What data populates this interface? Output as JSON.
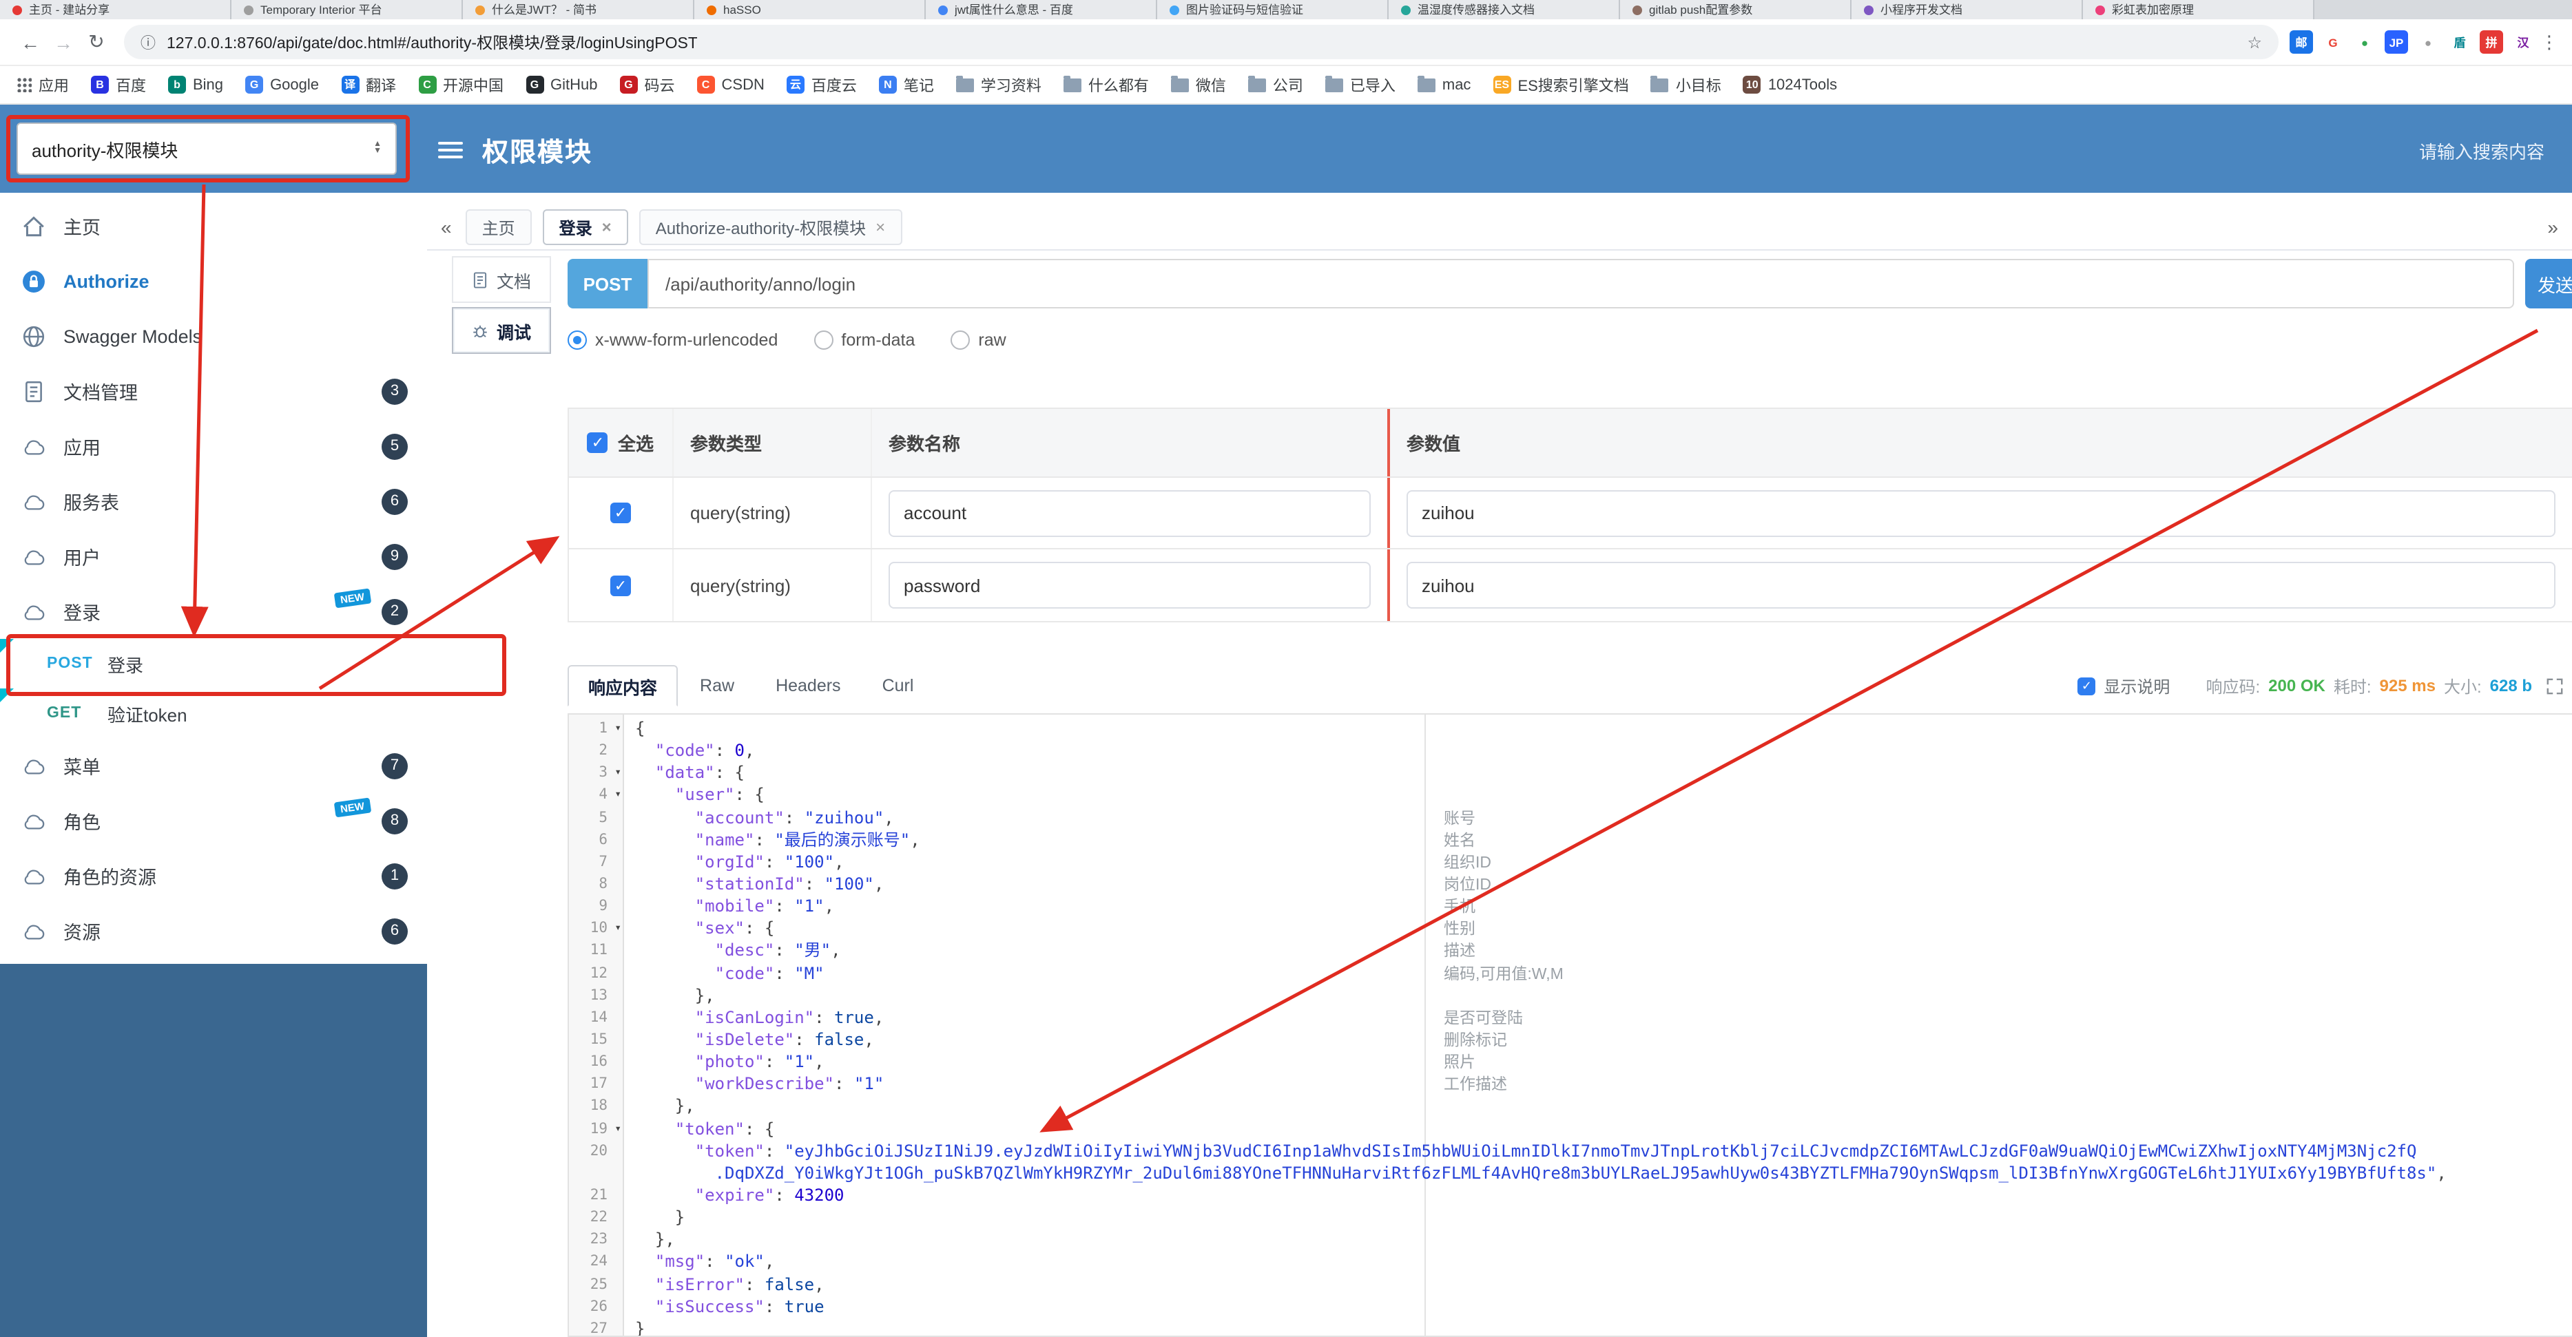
{
  "colors": {
    "header_blue": "#4a86c0",
    "sidebar_fill_blue": "#3a6790",
    "annotation_red": "#e02b20",
    "post_badge_blue": "#54a6dd",
    "send_button_blue": "#3e8ed8",
    "status_ok_green": "#46b450",
    "time_orange": "#ef9537",
    "size_teal": "#1c9fd6"
  },
  "browser": {
    "nav": {
      "back": "←",
      "forward": "→",
      "reload": "↻",
      "info": "ⓘ",
      "star": "☆",
      "menu": "⋮"
    },
    "url": "127.0.0.1:8760/api/gate/doc.html#/authority-权限模块/登录/loginUsingPOST",
    "tabs": [
      {
        "title": "主页 - 建站分享",
        "color": "#e53935"
      },
      {
        "title": "Temporary Interior 平台",
        "color": "#9e9e9e"
      },
      {
        "title": "什么是JWT？ - 简书",
        "color": "#f29d38"
      },
      {
        "title": "haSSO",
        "color": "#ef6c00"
      },
      {
        "title": "jwt属性什么意思 - 百度",
        "color": "#4285f4"
      },
      {
        "title": "图片验证码与短信验证",
        "color": "#42a5f5"
      },
      {
        "title": "温湿度传感器接入文档",
        "color": "#26a69a"
      },
      {
        "title": "gitlab push配置参数",
        "color": "#8d6e63"
      },
      {
        "title": "小程序开发文档",
        "color": "#7e57c2"
      },
      {
        "title": "彩虹表加密原理",
        "color": "#ec407a"
      }
    ],
    "extensions": [
      {
        "glyph": "邮",
        "bg": "#1a73e8",
        "fg": "#ffffff"
      },
      {
        "glyph": "G",
        "bg": "#ffffff",
        "fg": "#ea4335"
      },
      {
        "glyph": "●",
        "bg": "#ffffff",
        "fg": "#34a853"
      },
      {
        "glyph": "JP",
        "bg": "#2962ff",
        "fg": "#ffffff"
      },
      {
        "glyph": "●",
        "bg": "#ffffff",
        "fg": "#9e9e9e"
      },
      {
        "glyph": "盾",
        "bg": "#ffffff",
        "fg": "#00838f"
      },
      {
        "glyph": "拼",
        "bg": "#e53935",
        "fg": "#ffffff"
      },
      {
        "glyph": "汉",
        "bg": "#ffffff",
        "fg": "#7b1fa2"
      }
    ],
    "bookmarks": [
      {
        "label": "应用",
        "kind": "apps"
      },
      {
        "label": "百度",
        "kind": "chip",
        "letter": "B",
        "bg": "#2932e1"
      },
      {
        "label": "Bing",
        "kind": "chip",
        "letter": "b",
        "bg": "#008373"
      },
      {
        "label": "Google",
        "kind": "chip",
        "letter": "G",
        "bg": "#4285f4"
      },
      {
        "label": "翻译",
        "kind": "chip",
        "letter": "译",
        "bg": "#1a73e8"
      },
      {
        "label": "开源中国",
        "kind": "chip",
        "letter": "C",
        "bg": "#2e9e44"
      },
      {
        "label": "GitHub",
        "kind": "chip",
        "letter": "G",
        "bg": "#24292e"
      },
      {
        "label": "码云",
        "kind": "chip",
        "letter": "G",
        "bg": "#c71d23"
      },
      {
        "label": "CSDN",
        "kind": "chip",
        "letter": "C",
        "bg": "#fc5531"
      },
      {
        "label": "百度云",
        "kind": "chip",
        "letter": "云",
        "bg": "#2979ff"
      },
      {
        "label": "笔记",
        "kind": "chip",
        "letter": "N",
        "bg": "#3b7ef2"
      },
      {
        "label": "学习资料",
        "kind": "folder"
      },
      {
        "label": "什么都有",
        "kind": "folder"
      },
      {
        "label": "微信",
        "kind": "folder"
      },
      {
        "label": "公司",
        "kind": "folder"
      },
      {
        "label": "已导入",
        "kind": "folder"
      },
      {
        "label": "mac",
        "kind": "folder"
      },
      {
        "label": "ES搜索引擎文档",
        "kind": "chip",
        "letter": "ES",
        "bg": "#f9a825"
      },
      {
        "label": "小目标",
        "kind": "folder"
      },
      {
        "label": "1024Tools",
        "kind": "chip",
        "letter": "10",
        "bg": "#6d4c41"
      }
    ]
  },
  "header": {
    "project_select": "authority-权限模块",
    "title": "权限模块",
    "search_placeholder": "请输入搜索内容"
  },
  "sidebar": {
    "items": [
      {
        "label": "主页",
        "icon": "home",
        "type": "link"
      },
      {
        "label": "Authorize",
        "icon": "lock",
        "type": "link",
        "accent": true
      },
      {
        "label": "Swagger Models",
        "icon": "globe",
        "type": "link"
      },
      {
        "label": "文档管理",
        "icon": "doc",
        "badge": "3"
      },
      {
        "label": "应用",
        "icon": "cloud",
        "badge": "5"
      },
      {
        "label": "服务表",
        "icon": "cloud",
        "badge": "6"
      },
      {
        "label": "用户",
        "icon": "cloud",
        "badge": "9"
      },
      {
        "label": "登录",
        "icon": "cloud",
        "badge": "2",
        "new": true
      },
      {
        "label": "登录",
        "method": "POST",
        "type": "endpoint",
        "selected": true
      },
      {
        "label": "验证token",
        "method": "GET",
        "type": "endpoint"
      },
      {
        "label": "菜单",
        "icon": "cloud",
        "badge": "7"
      },
      {
        "label": "角色",
        "icon": "cloud",
        "badge": "8",
        "new": true
      },
      {
        "label": "角色的资源",
        "icon": "cloud",
        "badge": "1"
      },
      {
        "label": "资源",
        "icon": "cloud",
        "badge": "6"
      }
    ]
  },
  "doc_tabs": {
    "left_chevron": "«",
    "right_chevron": "»",
    "tabs": [
      {
        "label": "主页",
        "closable": false,
        "active": false
      },
      {
        "label": "登录",
        "closable": true,
        "active": true
      },
      {
        "label": "Authorize-authority-权限模块",
        "closable": true,
        "active": false
      }
    ]
  },
  "panel_tabs": [
    {
      "label": "文档",
      "icon": "doc",
      "active": false
    },
    {
      "label": "调试",
      "icon": "debug",
      "active": true
    }
  ],
  "request": {
    "method": "POST",
    "url": "/api/authority/anno/login",
    "send_label": "发送",
    "content_types": [
      "x-www-form-urlencoded",
      "form-data",
      "raw"
    ],
    "selected_type": "x-www-form-urlencoded"
  },
  "params_table": {
    "select_all_label": "全选",
    "headers": [
      "参数类型",
      "参数名称",
      "参数值"
    ],
    "rows": [
      {
        "checked": true,
        "type": "query(string)",
        "name": "account",
        "value": "zuihou"
      },
      {
        "checked": true,
        "type": "query(string)",
        "name": "password",
        "value": "zuihou"
      }
    ]
  },
  "response": {
    "tabs": [
      "响应内容",
      "Raw",
      "Headers",
      "Curl"
    ],
    "active_tab": "响应内容",
    "show_desc": "显示说明",
    "meta": [
      {
        "label": "响应码:",
        "value": "200 OK",
        "cls": "ok"
      },
      {
        "label": "耗时:",
        "value": "925 ms",
        "cls": "ms"
      },
      {
        "label": "大小:",
        "value": "628 b",
        "cls": "sz"
      }
    ]
  },
  "editor": {
    "lines": [
      {
        "n": 1,
        "fold": true,
        "t": [
          [
            "pu",
            "{"
          ]
        ]
      },
      {
        "n": 2,
        "t": [
          [
            "pu",
            "  "
          ],
          [
            "ky",
            "\"code\""
          ],
          [
            "pu",
            ": "
          ],
          [
            "nu",
            "0"
          ],
          [
            "pu",
            ","
          ]
        ]
      },
      {
        "n": 3,
        "fold": true,
        "t": [
          [
            "pu",
            "  "
          ],
          [
            "ky",
            "\"data\""
          ],
          [
            "pu",
            ": {"
          ]
        ]
      },
      {
        "n": 4,
        "fold": true,
        "t": [
          [
            "pu",
            "    "
          ],
          [
            "ky",
            "\"user\""
          ],
          [
            "pu",
            ": {"
          ]
        ]
      },
      {
        "n": 5,
        "c": "账号",
        "t": [
          [
            "pu",
            "      "
          ],
          [
            "ky",
            "\"account\""
          ],
          [
            "pu",
            ": "
          ],
          [
            "st",
            "\"zuihou\""
          ],
          [
            "pu",
            ","
          ]
        ]
      },
      {
        "n": 6,
        "c": "姓名",
        "t": [
          [
            "pu",
            "      "
          ],
          [
            "ky",
            "\"name\""
          ],
          [
            "pu",
            ": "
          ],
          [
            "st",
            "\"最后的演示账号\""
          ],
          [
            "pu",
            ","
          ]
        ]
      },
      {
        "n": 7,
        "c": "组织ID",
        "t": [
          [
            "pu",
            "      "
          ],
          [
            "ky",
            "\"orgId\""
          ],
          [
            "pu",
            ": "
          ],
          [
            "st",
            "\"100\""
          ],
          [
            "pu",
            ","
          ]
        ]
      },
      {
        "n": 8,
        "c": "岗位ID",
        "t": [
          [
            "pu",
            "      "
          ],
          [
            "ky",
            "\"stationId\""
          ],
          [
            "pu",
            ": "
          ],
          [
            "st",
            "\"100\""
          ],
          [
            "pu",
            ","
          ]
        ]
      },
      {
        "n": 9,
        "c": "手机",
        "t": [
          [
            "pu",
            "      "
          ],
          [
            "ky",
            "\"mobile\""
          ],
          [
            "pu",
            ": "
          ],
          [
            "st",
            "\"1\""
          ],
          [
            "pu",
            ","
          ]
        ]
      },
      {
        "n": 10,
        "fold": true,
        "c": "性别",
        "t": [
          [
            "pu",
            "      "
          ],
          [
            "ky",
            "\"sex\""
          ],
          [
            "pu",
            ": {"
          ]
        ]
      },
      {
        "n": 11,
        "c": "描述",
        "t": [
          [
            "pu",
            "        "
          ],
          [
            "ky",
            "\"desc\""
          ],
          [
            "pu",
            ": "
          ],
          [
            "st",
            "\"男\""
          ],
          [
            "pu",
            ","
          ]
        ]
      },
      {
        "n": 12,
        "c": "编码,可用值:W,M",
        "t": [
          [
            "pu",
            "        "
          ],
          [
            "ky",
            "\"code\""
          ],
          [
            "pu",
            ": "
          ],
          [
            "st",
            "\"M\""
          ]
        ]
      },
      {
        "n": 13,
        "t": [
          [
            "pu",
            "      },"
          ]
        ]
      },
      {
        "n": 14,
        "c": "是否可登陆",
        "t": [
          [
            "pu",
            "      "
          ],
          [
            "ky",
            "\"isCanLogin\""
          ],
          [
            "pu",
            ": "
          ],
          [
            "bo",
            "true"
          ],
          [
            "pu",
            ","
          ]
        ]
      },
      {
        "n": 15,
        "c": "删除标记",
        "t": [
          [
            "pu",
            "      "
          ],
          [
            "ky",
            "\"isDelete\""
          ],
          [
            "pu",
            ": "
          ],
          [
            "bo",
            "false"
          ],
          [
            "pu",
            ","
          ]
        ]
      },
      {
        "n": 16,
        "c": "照片",
        "t": [
          [
            "pu",
            "      "
          ],
          [
            "ky",
            "\"photo\""
          ],
          [
            "pu",
            ": "
          ],
          [
            "st",
            "\"1\""
          ],
          [
            "pu",
            ","
          ]
        ]
      },
      {
        "n": 17,
        "c": "工作描述",
        "t": [
          [
            "pu",
            "      "
          ],
          [
            "ky",
            "\"workDescribe\""
          ],
          [
            "pu",
            ": "
          ],
          [
            "st",
            "\"1\""
          ]
        ]
      },
      {
        "n": 18,
        "t": [
          [
            "pu",
            "    },"
          ]
        ]
      },
      {
        "n": 19,
        "fold": true,
        "t": [
          [
            "pu",
            "    "
          ],
          [
            "ky",
            "\"token\""
          ],
          [
            "pu",
            ": {"
          ]
        ]
      },
      {
        "n": 20,
        "t": [
          [
            "pu",
            "      "
          ],
          [
            "ky",
            "\"token\""
          ],
          [
            "pu",
            ": "
          ],
          [
            "st",
            "\"eyJhbGciOiJSUzI1NiJ9.eyJzdWIiOiIyIiwiYWNjb3VudCI6Inp1aWhvdSIsIm5hbWUiOiLmnIDlkI7nmoTmvJTnpLrotKblj7ciLCJvcmdpZCI6MTAwLCJzdGF0aW9uaWQiOjEwMCwiZXhwIjoxNTY4MjM3Njc2fQ"
          ]
        ]
      },
      {
        "n": "",
        "t": [
          [
            "st",
            "        .DqDXZd_Y0iWkgYJt1OGh_puSkB7QZlWmYkH9RZYMr_2uDul6mi88YOneTFHNNuHarviRtf6zFLMLf4AvHQre8m3bUYLRaeLJ95awhUyw0s43BYZTLFMHa79OynSWqpsm_lDI3BfnYnwXrgGOGTeL6htJ1YUIx6Yy19BYBfUft8s\""
          ],
          [
            "pu",
            ","
          ]
        ]
      },
      {
        "n": 21,
        "t": [
          [
            "pu",
            "      "
          ],
          [
            "ky",
            "\"expire\""
          ],
          [
            "pu",
            ": "
          ],
          [
            "nu",
            "43200"
          ]
        ]
      },
      {
        "n": 22,
        "t": [
          [
            "pu",
            "    }"
          ]
        ]
      },
      {
        "n": 23,
        "t": [
          [
            "pu",
            "  },"
          ]
        ]
      },
      {
        "n": 24,
        "t": [
          [
            "pu",
            "  "
          ],
          [
            "ky",
            "\"msg\""
          ],
          [
            "pu",
            ": "
          ],
          [
            "st",
            "\"ok\""
          ],
          [
            "pu",
            ","
          ]
        ]
      },
      {
        "n": 25,
        "t": [
          [
            "pu",
            "  "
          ],
          [
            "ky",
            "\"isError\""
          ],
          [
            "pu",
            ": "
          ],
          [
            "bo",
            "false"
          ],
          [
            "pu",
            ","
          ]
        ]
      },
      {
        "n": 26,
        "t": [
          [
            "pu",
            "  "
          ],
          [
            "ky",
            "\"isSuccess\""
          ],
          [
            "pu",
            ": "
          ],
          [
            "bo",
            "true"
          ]
        ]
      },
      {
        "n": 27,
        "t": [
          [
            "pu",
            "}"
          ]
        ]
      }
    ]
  }
}
